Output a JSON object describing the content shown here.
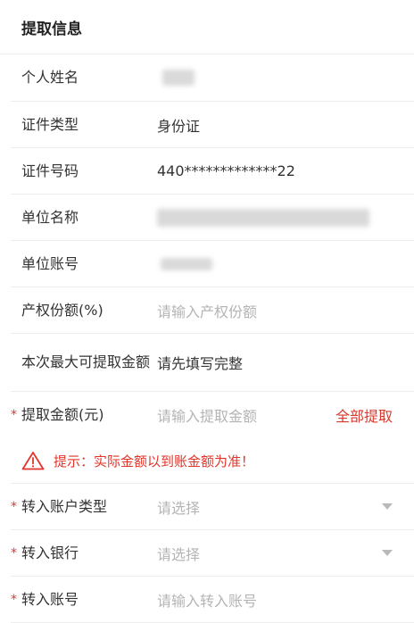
{
  "header": {
    "title": "提取信息"
  },
  "fields": {
    "name": {
      "label": "个人姓名"
    },
    "id_type": {
      "label": "证件类型",
      "value": "身份证"
    },
    "id_number": {
      "label": "证件号码",
      "value": "440*************22"
    },
    "company_name": {
      "label": "单位名称"
    },
    "company_account": {
      "label": "单位账号"
    },
    "property_share": {
      "label": "产权份额(%)",
      "placeholder": "请输入产权份额"
    },
    "max_amount": {
      "label": "本次最大可提取金额",
      "value": "请先填写完整"
    },
    "withdraw_amount": {
      "label": "提取金额(元)",
      "placeholder": "请输入提取金额",
      "action": "全部提取"
    },
    "account_type": {
      "label": "转入账户类型",
      "placeholder": "请选择"
    },
    "bank": {
      "label": "转入银行",
      "placeholder": "请选择"
    },
    "account_number": {
      "label": "转入账号",
      "placeholder": "请输入转入账号"
    }
  },
  "tip": {
    "text": "提示：实际金额以到账金额为准！",
    "icon": "warning-icon"
  },
  "required_mark": "*",
  "colors": {
    "accent": "#d93a2e",
    "placeholder": "#b4b4b4",
    "divider": "#ececec"
  }
}
